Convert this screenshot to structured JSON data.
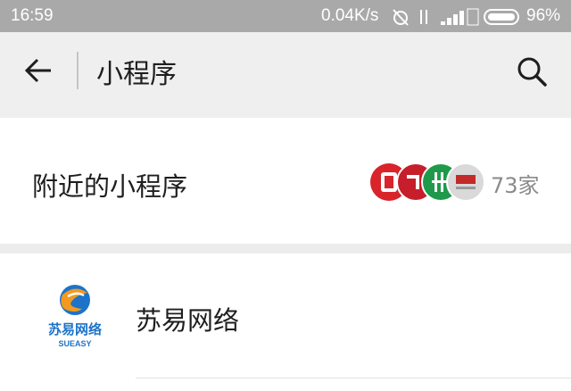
{
  "status_bar": {
    "time": "16:59",
    "network_speed": "0.04K/s",
    "battery_percent": "96%",
    "icons": [
      "alarm-off-icon",
      "data-arrows-icon",
      "signal-icon",
      "battery-icon"
    ]
  },
  "header": {
    "title": "小程序",
    "icons": [
      "back-arrow-icon",
      "search-icon"
    ]
  },
  "nearby": {
    "label": "附近的小程序",
    "count": "73家"
  },
  "apps": [
    {
      "name": "苏易网络",
      "logo_text": "苏易网络",
      "logo_subtext": "SUEASY"
    }
  ],
  "colors": {
    "status_bar_bg": "#a9a9a9",
    "header_bg": "#efefef",
    "row_bg": "#ffffff",
    "section_gap": "#ececec",
    "text_primary": "#1e1e1e",
    "text_secondary": "#8a8a8a",
    "logo_blue": "#1d73c9",
    "logo_orange": "#f39a1e"
  }
}
